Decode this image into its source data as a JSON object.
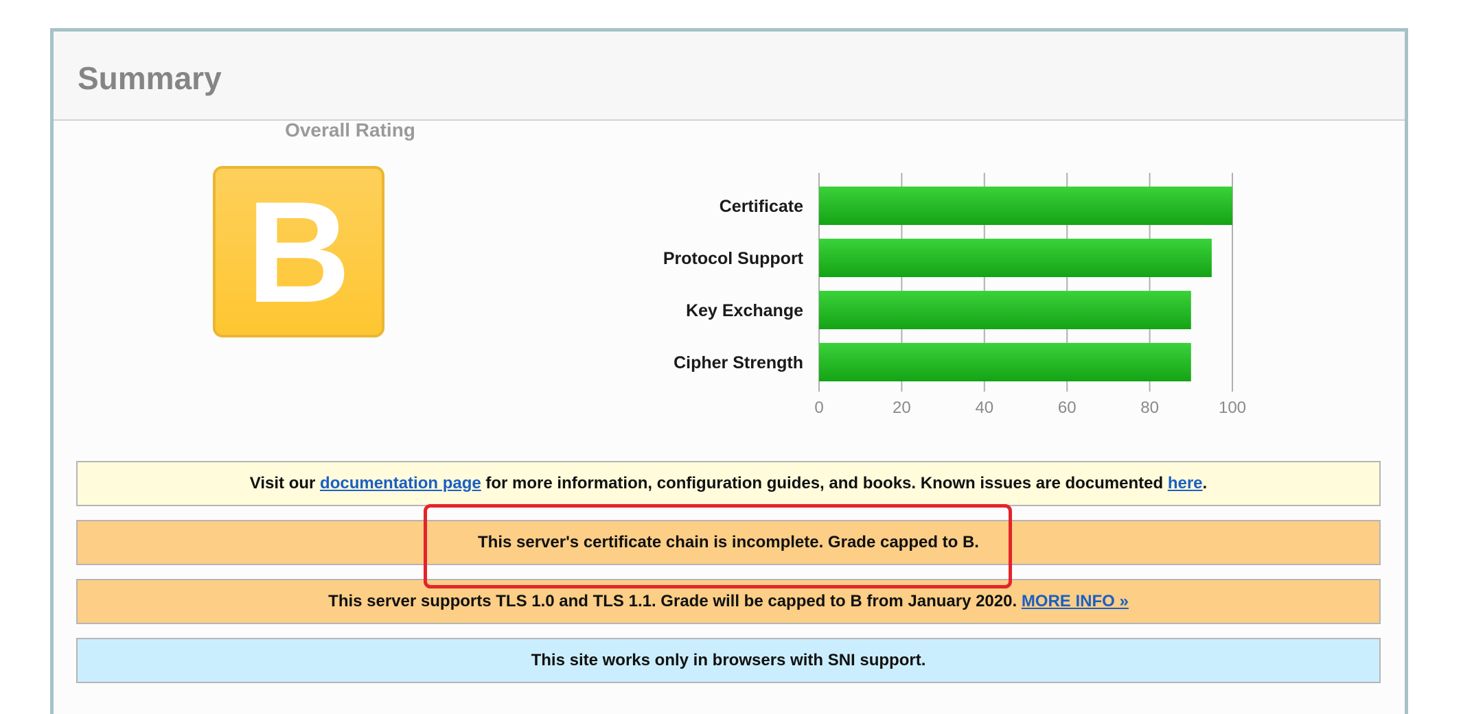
{
  "summary": {
    "title": "Summary",
    "overall_rating_label": "Overall Rating",
    "grade": "B",
    "grade_color": "#fec631"
  },
  "chart_data": {
    "type": "bar",
    "orientation": "horizontal",
    "categories": [
      "Certificate",
      "Protocol Support",
      "Key Exchange",
      "Cipher Strength"
    ],
    "values": [
      100,
      95,
      90,
      90
    ],
    "xlim": [
      0,
      100
    ],
    "xticks": [
      "0",
      "20",
      "40",
      "60",
      "80",
      "100"
    ],
    "grid": true,
    "bar_color": "#22b822"
  },
  "notices": {
    "docs": {
      "prefix": "Visit our ",
      "link1": "documentation page",
      "middle": " for more information, configuration guides, and books. Known issues are documented ",
      "link2": "here",
      "suffix": "."
    },
    "chain": {
      "text": "This server's certificate chain is incomplete. Grade capped to B."
    },
    "tls": {
      "text": "This server supports TLS 1.0 and TLS 1.1. Grade will be capped to B from January 2020. ",
      "link": "MORE INFO »"
    },
    "sni": {
      "text": "This site works only in browsers with SNI support."
    }
  },
  "colors": {
    "panel_border": "#a6c2c8",
    "notice_yellow": "#fffbdb",
    "notice_orange": "#fcce86",
    "notice_blue": "#cbeefe",
    "link": "#1a5fc4",
    "highlight": "#e3242b"
  }
}
